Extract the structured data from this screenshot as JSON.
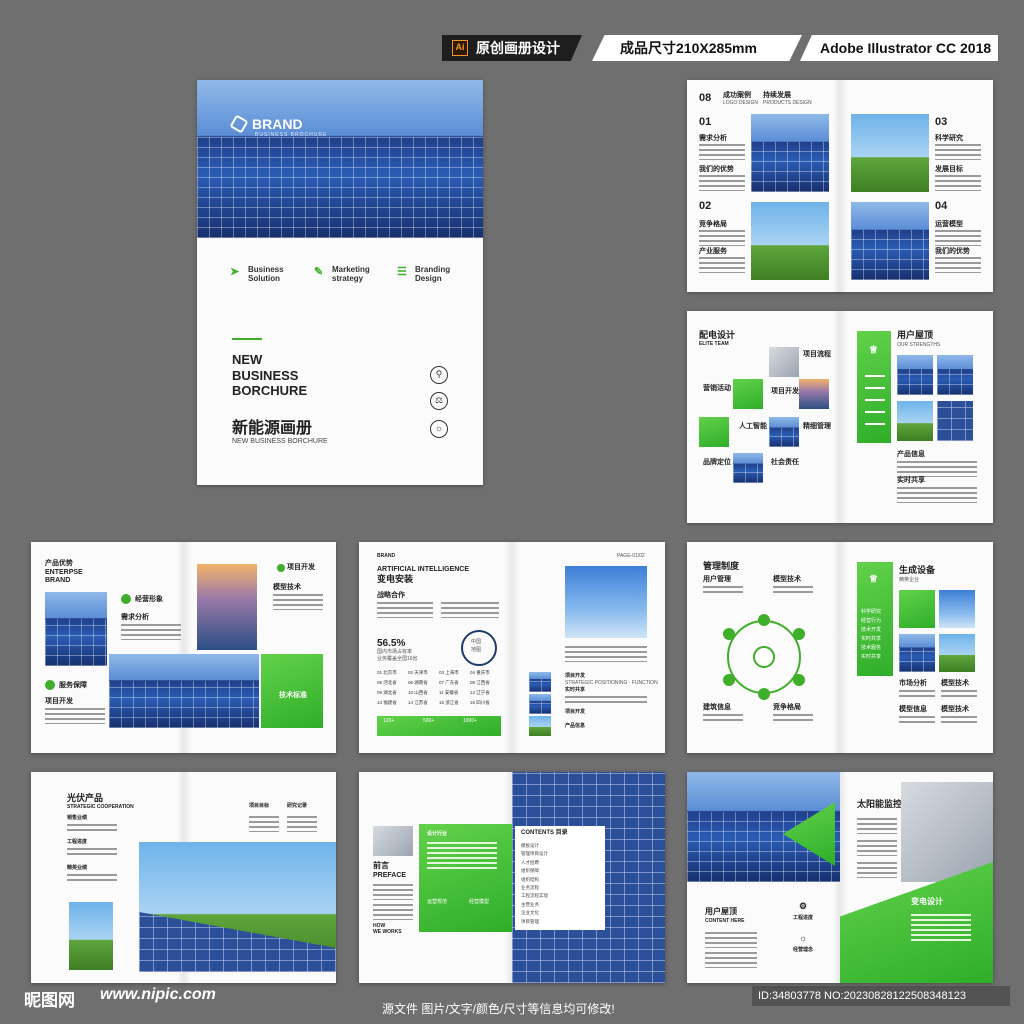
{
  "header": {
    "tag1_icon": "Ai",
    "tag1": "原创画册设计",
    "tag2": "成品尺寸210X285mm",
    "tag3": "Adobe Illustrator CC 2018"
  },
  "cover": {
    "brand": "BRAND",
    "brand_sub": "BUSINESS BROCHURE",
    "items": [
      {
        "icon": "paper-plane-icon",
        "line1": "Business",
        "line2": "Solution"
      },
      {
        "icon": "pen-icon",
        "line1": "Marketing",
        "line2": "strategy"
      },
      {
        "icon": "layers-icon",
        "line1": "Branding",
        "line2": "Design"
      }
    ],
    "title": [
      "NEW",
      "BUSINESS",
      "BORCHURE"
    ],
    "title_cn": "新能源画册",
    "subtitle": "NEW BUSINESS BORCHURE"
  },
  "spread1": {
    "head_num": "08",
    "head_a": "成功案例",
    "head_a_sub": "LOGO DESIGN",
    "head_b": "持续发展",
    "head_b_sub": "PRODUCTS DESIGN",
    "items": [
      {
        "num": "01",
        "label_a": "需求分析",
        "label_b": "我们的优势"
      },
      {
        "num": "02",
        "label_a": "竞争格局",
        "label_b": "产业服务"
      },
      {
        "num": "03",
        "label_a": "科学研究",
        "label_b": "发展目标"
      },
      {
        "num": "04",
        "label_a": "运营模型",
        "label_b": "我们的优势"
      }
    ]
  },
  "spread2": {
    "title": "配电设计",
    "title_en": "ELITE TEAM",
    "labels": [
      "项目流程",
      "营销活动",
      "项目开发",
      "人工智能",
      "精细管理",
      "品牌定位",
      "社会责任"
    ],
    "right_title": "用户屋顶",
    "right_sub": "OUR STRENGTHS",
    "right_labels": [
      "产品信息",
      "实时共享"
    ]
  },
  "spread3": {
    "title": "产品优势",
    "title_en": [
      "ENTERPSE",
      "BRAND"
    ],
    "labels": [
      "经营形象",
      "需求分析",
      "服务保障",
      "项目开发",
      "项目开发",
      "模型技术",
      "技术标准"
    ]
  },
  "spread4": {
    "brand": "BRAND",
    "page": "PAGE-01/02",
    "title_en": "ARTIFICIAL INTELLIGENCE",
    "title_cn": "变电安装",
    "section": "战略合作",
    "percent": "56.5%",
    "desc1": "国内市场占有率",
    "desc2": "业务覆盖全国16省",
    "circle": [
      "中国",
      "地图"
    ],
    "cities": [
      "01 北京市",
      "02 天津市",
      "03 上海市",
      "04 重庆市",
      "05 河北省",
      "06 湖南省",
      "07 广东省",
      "08 江西省",
      "09 湖北省",
      "10 山西省",
      "11 安徽省",
      "12 辽宁省",
      "13 福建省",
      "14 江苏省",
      "15 浙江省",
      "16 四川省"
    ],
    "bar_values": [
      "120+",
      "500+",
      "1000+"
    ],
    "right_labels": [
      "项目开发",
      "STRATEGIC POSITIONING · FUNCTION",
      "实时共享",
      "项目开发",
      "产品信息"
    ]
  },
  "spread5": {
    "title": "管理制度",
    "labels": [
      "用户管理",
      "模型技术",
      "建筑信息",
      "竞争格局"
    ],
    "right_title": "生成设备",
    "right_sub": "精英企业",
    "list": [
      "科学研究",
      "经营行为",
      "技术开发",
      "实时共享",
      "技术服务",
      "实时共享"
    ],
    "right_labels": [
      "市场分析",
      "模型技术",
      "模型信息",
      "模型技术"
    ]
  },
  "spread6": {
    "title": "光伏产品",
    "title_en": "STRATEGIC COOPERATION",
    "labels": [
      "销售业绩",
      "工程进度",
      "精英业绩",
      "项目目标",
      "研究记录"
    ]
  },
  "spread7": {
    "title_cn": "前言",
    "title_en": "PREFACE",
    "small": [
      "HOW",
      "WE WORKS"
    ],
    "green_title": "设计行业",
    "green_items": [
      "运营规范",
      "经营模型"
    ],
    "contents_title": "CONTENTS 目录",
    "contents": [
      "模板设计",
      "管理项目设计",
      "人才招聘",
      "组织保障",
      "组织结构",
      "业务流程",
      "工程流程实现",
      "主营业务",
      "企业文化",
      "项目管理"
    ]
  },
  "spread8": {
    "title": "太阳能监控",
    "left_title": "用户屋顶",
    "left_sub": "CONTENT HERE",
    "icons": [
      "工程进度",
      "经营理念"
    ],
    "green_title": "变电设计"
  },
  "footer": {
    "logo": "昵图网",
    "url": "www.nipic.com",
    "note": "源文件 图片/文字/颜色/尺寸等信息均可修改!",
    "id": "ID:34803778 NO:20230828122508348123"
  }
}
